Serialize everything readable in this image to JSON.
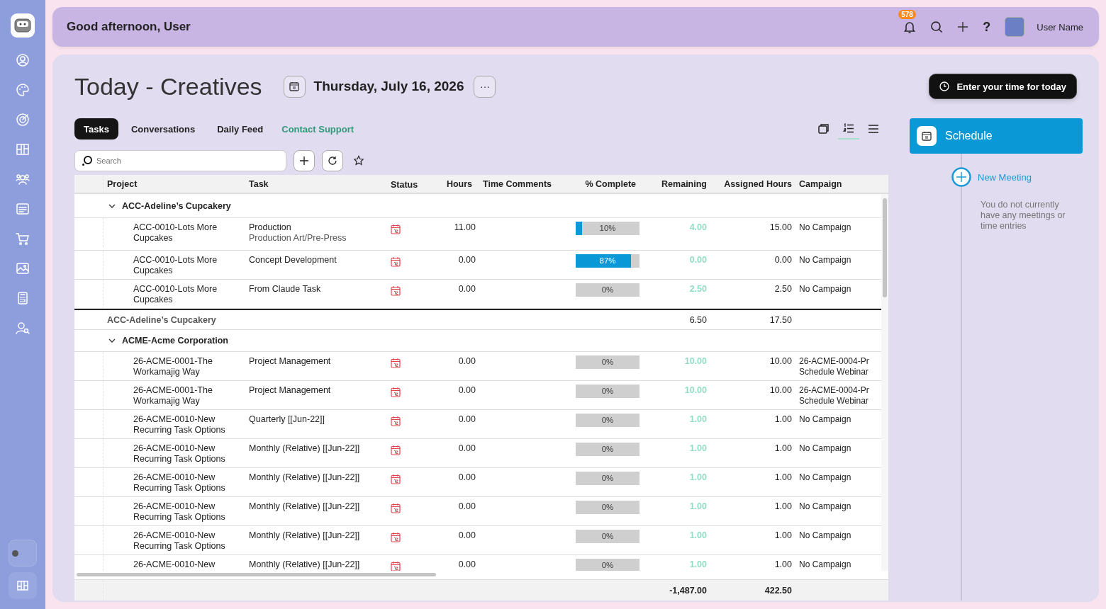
{
  "header": {
    "greeting": "Good afternoon, User",
    "notifications": "578",
    "help": "?",
    "user_name": "User Name"
  },
  "sidebar": {
    "theme_toggle": {
      "on": false
    }
  },
  "page": {
    "title": "Today - Creatives",
    "date": "Thursday, July 16, 2026",
    "more": "···",
    "time_button": "Enter your time for today"
  },
  "tabs": [
    {
      "label": "Tasks",
      "selected": true
    },
    {
      "label": "Conversations",
      "selected": false
    },
    {
      "label": "Daily Feed",
      "selected": false
    }
  ],
  "support_link": "Contact Support",
  "views": [
    {
      "kind": "cards",
      "selected": false
    },
    {
      "kind": "numbered",
      "selected": true
    },
    {
      "kind": "list",
      "selected": false
    }
  ],
  "search": {
    "placeholder": "Search"
  },
  "table": {
    "columns": [
      "Project",
      "Task",
      "Status",
      "Hours",
      "Time Comments",
      "% Complete",
      "Remaining",
      "Assigned Hours",
      "Campaign"
    ],
    "rows": [
      {
        "kind": "group",
        "name": "ACC-Adeline’s Cupcakery",
        "expanded": true
      },
      {
        "kind": "task",
        "project": "ACC-0010-Lots More Cupcakes",
        "task": "Production",
        "subtask": "Production Art/Pre-Press",
        "hours": "11.00",
        "complete": "10%",
        "level": 0.1,
        "remaining": "4.00",
        "assigned": "15.00",
        "campaign": [
          "No Campaign"
        ]
      },
      {
        "kind": "task",
        "project": "ACC-0010-Lots More Cupcakes",
        "task": "Concept Development",
        "hours": "0.00",
        "complete": "87%",
        "level": 0.87,
        "remaining": "0.00",
        "assigned": "0.00",
        "campaign": [
          "No Campaign"
        ]
      },
      {
        "kind": "task",
        "project": "ACC-0010-Lots More Cupcakes",
        "task": "From Claude Task",
        "hours": "0.00",
        "complete": "0%",
        "level": 0,
        "remaining": "2.50",
        "assigned": "2.50",
        "campaign": [
          "No Campaign"
        ]
      },
      {
        "kind": "subtotal",
        "name": "ACC-Adeline’s Cupcakery",
        "remaining": "6.50",
        "assigned": "17.50"
      },
      {
        "kind": "group",
        "name": "ACME-Acme Corporation",
        "expanded": true
      },
      {
        "kind": "task",
        "project": "26-ACME-0001-The Workamajig Way",
        "task": "Project Management",
        "hours": "0.00",
        "complete": "0%",
        "level": 0,
        "remaining": "10.00",
        "assigned": "10.00",
        "campaign": [
          "26-ACME-0004-Pr",
          "Schedule Webinar"
        ]
      },
      {
        "kind": "task",
        "project": "26-ACME-0001-The Workamajig Way",
        "task": "Project Management",
        "hours": "0.00",
        "complete": "0%",
        "level": 0,
        "remaining": "10.00",
        "assigned": "10.00",
        "campaign": [
          "26-ACME-0004-Pr",
          "Schedule Webinar"
        ]
      },
      {
        "kind": "task",
        "project": "26-ACME-0010-New Recurring Task Options",
        "task": "Quarterly [[Jun-22]]",
        "hours": "0.00",
        "complete": "0%",
        "level": 0,
        "remaining": "1.00",
        "assigned": "1.00",
        "campaign": [
          "No Campaign"
        ]
      },
      {
        "kind": "task",
        "project": "26-ACME-0010-New Recurring Task Options",
        "task": "Monthly (Relative) [[Jun-22]]",
        "hours": "0.00",
        "complete": "0%",
        "level": 0,
        "remaining": "1.00",
        "assigned": "1.00",
        "campaign": [
          "No Campaign"
        ]
      },
      {
        "kind": "task",
        "project": "26-ACME-0010-New Recurring Task Options",
        "task": "Monthly (Relative) [[Jun-22]]",
        "hours": "0.00",
        "complete": "0%",
        "level": 0,
        "remaining": "1.00",
        "assigned": "1.00",
        "campaign": [
          "No Campaign"
        ]
      },
      {
        "kind": "task",
        "project": "26-ACME-0010-New Recurring Task Options",
        "task": "Monthly (Relative) [[Jun-22]]",
        "hours": "0.00",
        "complete": "0%",
        "level": 0,
        "remaining": "1.00",
        "assigned": "1.00",
        "campaign": [
          "No Campaign"
        ]
      },
      {
        "kind": "task",
        "project": "26-ACME-0010-New Recurring Task Options",
        "task": "Monthly (Relative) [[Jun-22]]",
        "hours": "0.00",
        "complete": "0%",
        "level": 0,
        "remaining": "1.00",
        "assigned": "1.00",
        "campaign": [
          "No Campaign"
        ]
      },
      {
        "kind": "task",
        "project": "26-ACME-0010-New",
        "task": "Monthly (Relative) [[Jun-22]]",
        "hours": "0.00",
        "complete": "0%",
        "level": 0,
        "remaining": "1.00",
        "assigned": "1.00",
        "campaign": [
          "No Campaign"
        ]
      }
    ],
    "totals": {
      "remaining": "-1,487.00",
      "assigned": "422.50"
    }
  },
  "schedule": {
    "title": "Schedule",
    "new_meeting": "New Meeting",
    "empty": "You do not currently have any meetings or time entries"
  }
}
